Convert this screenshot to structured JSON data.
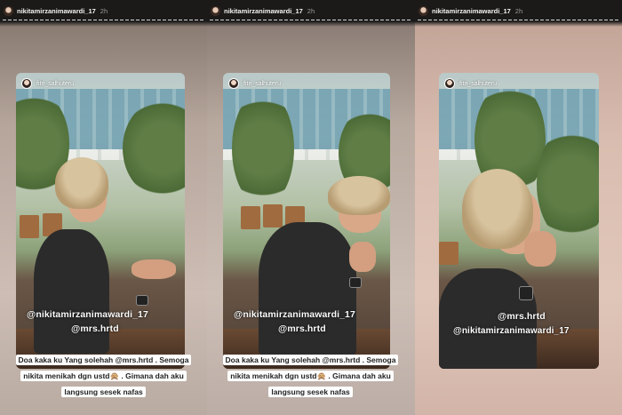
{
  "colors": {
    "topbar_bg": "#1c1a19",
    "caption_bg": "#ffffff",
    "caption_text": "#222222",
    "mention_text": "#ffffff"
  },
  "panels": [
    {
      "topbar": {
        "username": "nikitamirzanimawardi_17",
        "time": "2h"
      },
      "story": {
        "username": "fitri_salhuteru",
        "mentions": [
          "@nikitamirzanimawardi_17",
          "@mrs.hrtd"
        ],
        "caption_lines": [
          "Doa kaka ku Yang solehah @mrs.hrtd . Semoga",
          "nikita menikah dgn ustd🙊 . Gimana dah aku",
          "langsung sesek nafas"
        ]
      }
    },
    {
      "topbar": {
        "username": "nikitamirzanimawardi_17",
        "time": "2h"
      },
      "story": {
        "username": "fitri_salhuteru",
        "mentions": [
          "@nikitamirzanimawardi_17",
          "@mrs.hrtd"
        ],
        "caption_lines": [
          "Doa kaka ku Yang solehah @mrs.hrtd . Semoga",
          "nikita menikah dgn ustd🙊 . Gimana dah aku",
          "langsung sesek nafas"
        ]
      }
    },
    {
      "topbar": {
        "username": "nikitamirzanimawardi_17",
        "time": "2h"
      },
      "story": {
        "username": "fitri_salhuteru",
        "mentions": [
          "@mrs.hrtd",
          "@nikitamirzanimawardi_17"
        ]
      }
    }
  ]
}
